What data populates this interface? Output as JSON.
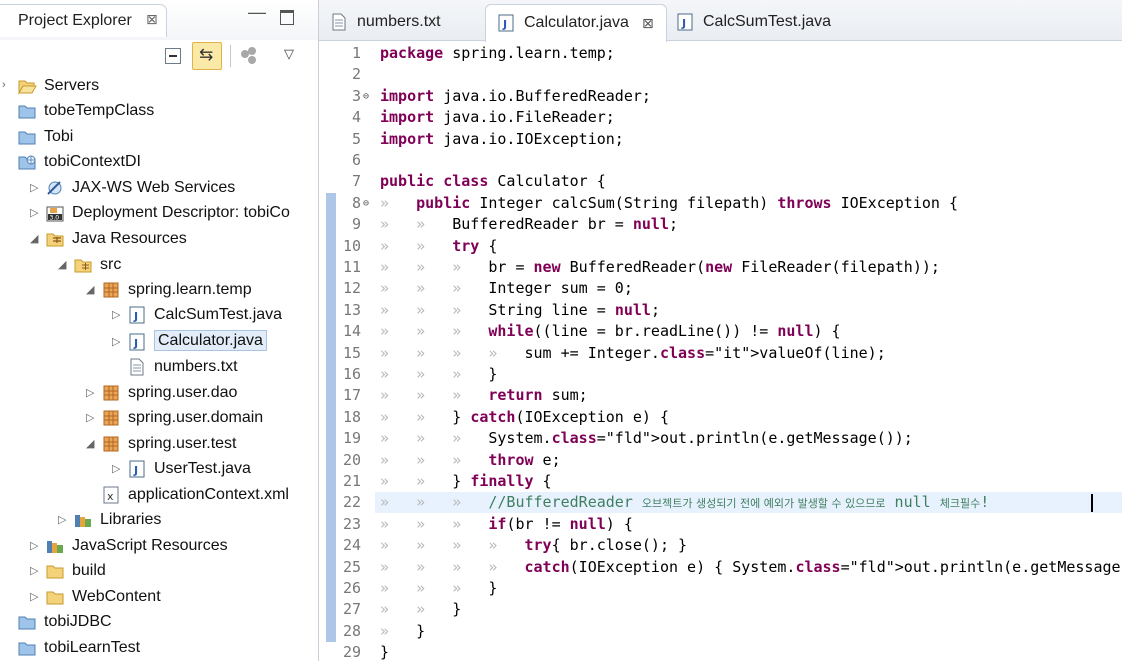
{
  "explorer": {
    "title": "Project Explorer",
    "close_glyph": "⊠"
  },
  "tree": [
    {
      "label": "Servers",
      "icon": "folder-open-icon",
      "toggle": "›"
    },
    {
      "label": "tobeTempClass",
      "icon": "project-icon",
      "toggle": ""
    },
    {
      "label": "Tobi",
      "icon": "project-icon",
      "toggle": ""
    },
    {
      "label": "tobiContextDI",
      "icon": "web-project-icon",
      "toggle": ""
    },
    {
      "label": "JAX-WS Web Services",
      "icon": "webservices-icon",
      "toggle": "▷"
    },
    {
      "label": "Deployment Descriptor: tobiCo",
      "icon": "deployment-descriptor-icon",
      "toggle": "▷"
    },
    {
      "label": "Java Resources",
      "icon": "java-resources-icon",
      "toggle": "◢"
    },
    {
      "label": "src",
      "icon": "source-folder-icon",
      "toggle": "◢"
    },
    {
      "label": "spring.learn.temp",
      "icon": "package-icon",
      "toggle": "◢"
    },
    {
      "label": "CalcSumTest.java",
      "icon": "java-file-icon",
      "toggle": "▷"
    },
    {
      "label": "Calculator.java",
      "icon": "java-file-icon",
      "toggle": "▷"
    },
    {
      "label": "numbers.txt",
      "icon": "text-file-icon",
      "toggle": ""
    },
    {
      "label": "spring.user.dao",
      "icon": "package-icon",
      "toggle": "▷"
    },
    {
      "label": "spring.user.domain",
      "icon": "package-icon",
      "toggle": "▷"
    },
    {
      "label": "spring.user.test",
      "icon": "package-icon",
      "toggle": "◢"
    },
    {
      "label": "UserTest.java",
      "icon": "java-file-icon",
      "toggle": "▷"
    },
    {
      "label": "applicationContext.xml",
      "icon": "xml-file-icon",
      "toggle": ""
    },
    {
      "label": "Libraries",
      "icon": "library-icon",
      "toggle": "▷"
    },
    {
      "label": "JavaScript Resources",
      "icon": "library-icon",
      "toggle": "▷"
    },
    {
      "label": "build",
      "icon": "folder-icon",
      "toggle": "▷"
    },
    {
      "label": "WebContent",
      "icon": "folder-icon",
      "toggle": "▷"
    },
    {
      "label": "tobiJDBC",
      "icon": "project-icon",
      "toggle": ""
    },
    {
      "label": "tobiLearnTest",
      "icon": "project-icon",
      "toggle": ""
    }
  ],
  "editor": {
    "tabs": [
      {
        "label": "numbers.txt",
        "icon": "text-file-icon"
      },
      {
        "label": "Calculator.java",
        "icon": "java-file-icon",
        "close_glyph": "⊠"
      },
      {
        "label": "CalcSumTest.java",
        "icon": "java-file-icon"
      }
    ],
    "line_numbers": [
      "1",
      "2",
      "3",
      "4",
      "5",
      "6",
      "7",
      "8",
      "9",
      "10",
      "11",
      "12",
      "13",
      "14",
      "15",
      "16",
      "17",
      "18",
      "19",
      "20",
      "21",
      "22",
      "23",
      "24",
      "25",
      "26",
      "27",
      "28",
      "29"
    ],
    "fold_markers": {
      "3": "⊖",
      "8": "⊖"
    },
    "lines": [
      "package spring.learn.temp;",
      "",
      "import java.io.BufferedReader;",
      "import java.io.FileReader;",
      "import java.io.IOException;",
      "",
      "public class Calculator {",
      "\tpublic Integer calcSum(String filepath) throws IOException {",
      "\t\tBufferedReader br = null;",
      "\t\ttry {",
      "\t\t\tbr = new BufferedReader(new FileReader(filepath));",
      "\t\t\tInteger sum = 0;",
      "\t\t\tString line = null;",
      "\t\t\twhile((line = br.readLine()) != null) {",
      "\t\t\t\tsum += Integer.valueOf(line);",
      "\t\t\t}",
      "\t\t\treturn sum;",
      "\t\t} catch(IOException e) {",
      "\t\t\tSystem.out.println(e.getMessage());",
      "\t\t\tthrow e;",
      "\t\t} finally {",
      "\t\t\t//BufferedReader 오브젝트가 생성되기 전에 예외가 발생할 수 있으므로 null 체크필수!",
      "\t\t\tif(br != null) {",
      "\t\t\t\ttry{ br.close(); }",
      "\t\t\t\tcatch(IOException e) { System.out.println(e.getMessage());",
      "\t\t\t}",
      "\t\t}",
      "\t}",
      "}"
    ],
    "current_line": 22
  }
}
